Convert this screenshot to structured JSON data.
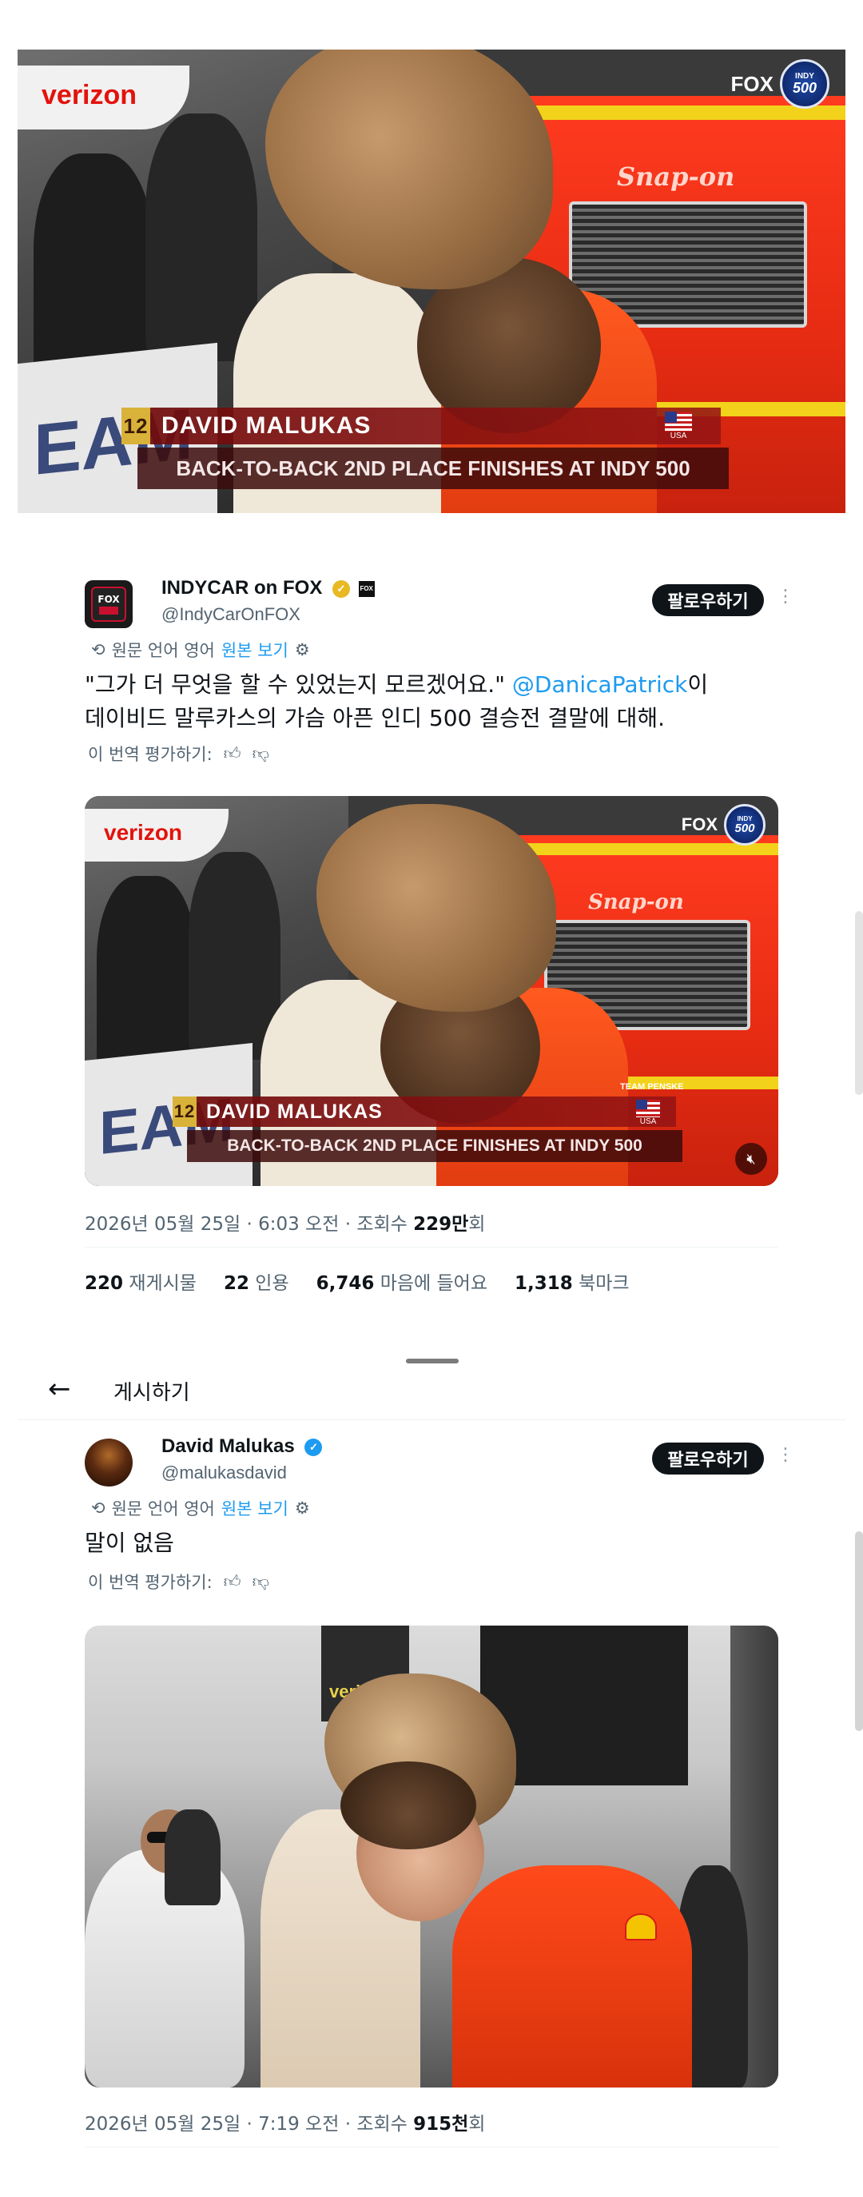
{
  "top_video": {
    "overlay": {
      "number": "12",
      "name": "DAVID MALUKAS",
      "country": "USA",
      "subtitle": "BACK-TO-BACK 2ND PLACE FINISHES AT INDY 500"
    },
    "logos": {
      "fox": "FOX",
      "indy_top": "INDY",
      "indy_num": "500",
      "verizon": "verizon",
      "snapon": "Snap-on",
      "wall": "EAM"
    }
  },
  "tweet1": {
    "author_name": "INDYCAR on FOX",
    "author_handle": "@IndyCarOnFOX",
    "avatar_text": "FOX",
    "follow_label": "팔로우하기",
    "more_icon": "more-icon",
    "translate_note": "원문 언어 영어",
    "show_original": "원본 보기",
    "text_part1": "\"그가 더 무엇을 할 수 있었는지 모르겠어요.\" ",
    "mention": "@DanicaPatrick",
    "text_part2": "이",
    "text_line2": "데이비드 말루카스의 가슴 아픈 인디 500 결승전 결말에 대해.",
    "rate_label": "이 번역 평가하기:",
    "media_overlay": {
      "number": "12",
      "name": "DAVID MALUKAS",
      "country": "USA",
      "subtitle": "BACK-TO-BACK 2ND PLACE FINISHES AT INDY 500",
      "team": "TEAM PENSKE"
    },
    "meta_prefix": "2026년 05월 25일 · 6:03 오전 · 조회수 ",
    "meta_views": "229만",
    "meta_suffix": "회",
    "stats": [
      {
        "value": "220",
        "label": "재게시물"
      },
      {
        "value": "22",
        "label": "인용"
      },
      {
        "value": "6,746",
        "label": "마음에 들어요"
      },
      {
        "value": "1,318",
        "label": "북마크"
      }
    ]
  },
  "header": {
    "back_icon": "back-arrow-icon",
    "title": "게시하기"
  },
  "tweet2": {
    "author_name": "David Malukas",
    "author_handle": "@malukasdavid",
    "follow_label": "팔로우하기",
    "translate_note": "원문 언어 영어",
    "show_original": "원본 보기",
    "text": "말이 없음",
    "rate_label": "이 번역 평가하기:",
    "photo_logo": "verizon",
    "meta_prefix": "2026년 05월 25일 · 7:19 오전 · 조회수 ",
    "meta_views": "915천",
    "meta_suffix": "회"
  },
  "colors": {
    "accent": "#1d9bf0",
    "verified_gold": "#e8b923",
    "verified_blue": "#1d9bf0",
    "text": "#0f1419",
    "muted": "#536471"
  }
}
